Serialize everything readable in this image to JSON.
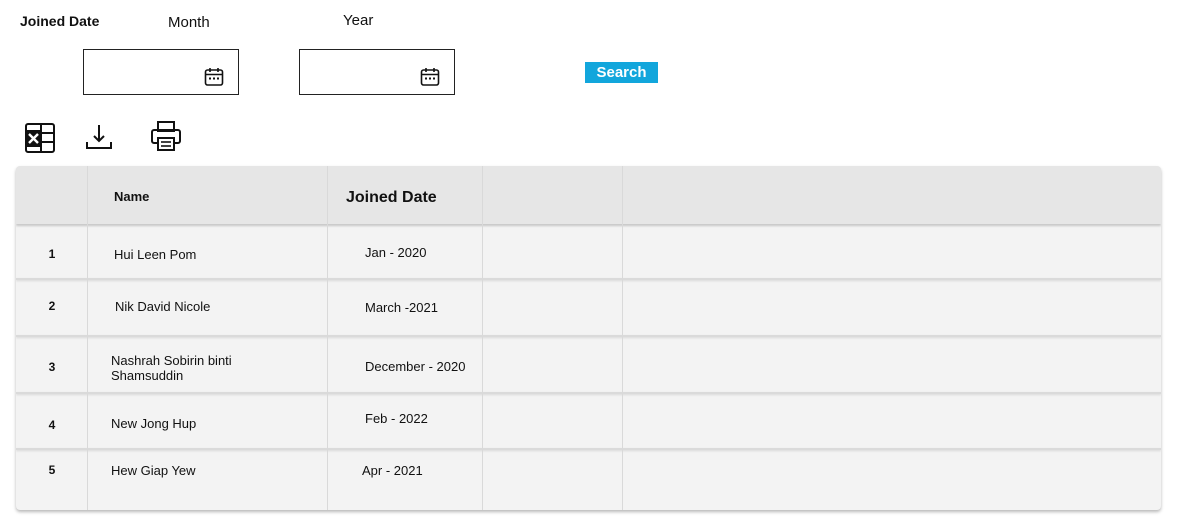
{
  "filters": {
    "joined_date_label": "Joined Date",
    "month_label": "Month",
    "year_label": "Year",
    "month_value": "",
    "year_value": "",
    "search_label": "Search",
    "search_color": "#12a6dc"
  },
  "toolbar": {
    "icons": [
      "excel-icon",
      "download-icon",
      "print-icon"
    ]
  },
  "table": {
    "headers": [
      "",
      "Name",
      "Joined Date",
      "",
      ""
    ],
    "rows": [
      {
        "no": "1",
        "name": "Hui Leen Pom",
        "joined": "Jan - 2020"
      },
      {
        "no": "2",
        "name": "Nik David Nicole",
        "joined": "March -2021"
      },
      {
        "no": "3",
        "name": "Nashrah Sobirin binti Shamsuddin",
        "joined": "December - 2020"
      },
      {
        "no": "4",
        "name": "New Jong Hup",
        "joined": "Feb - 2022"
      },
      {
        "no": "5",
        "name": "Hew Giap Yew",
        "joined": "Apr - 2021"
      }
    ]
  }
}
